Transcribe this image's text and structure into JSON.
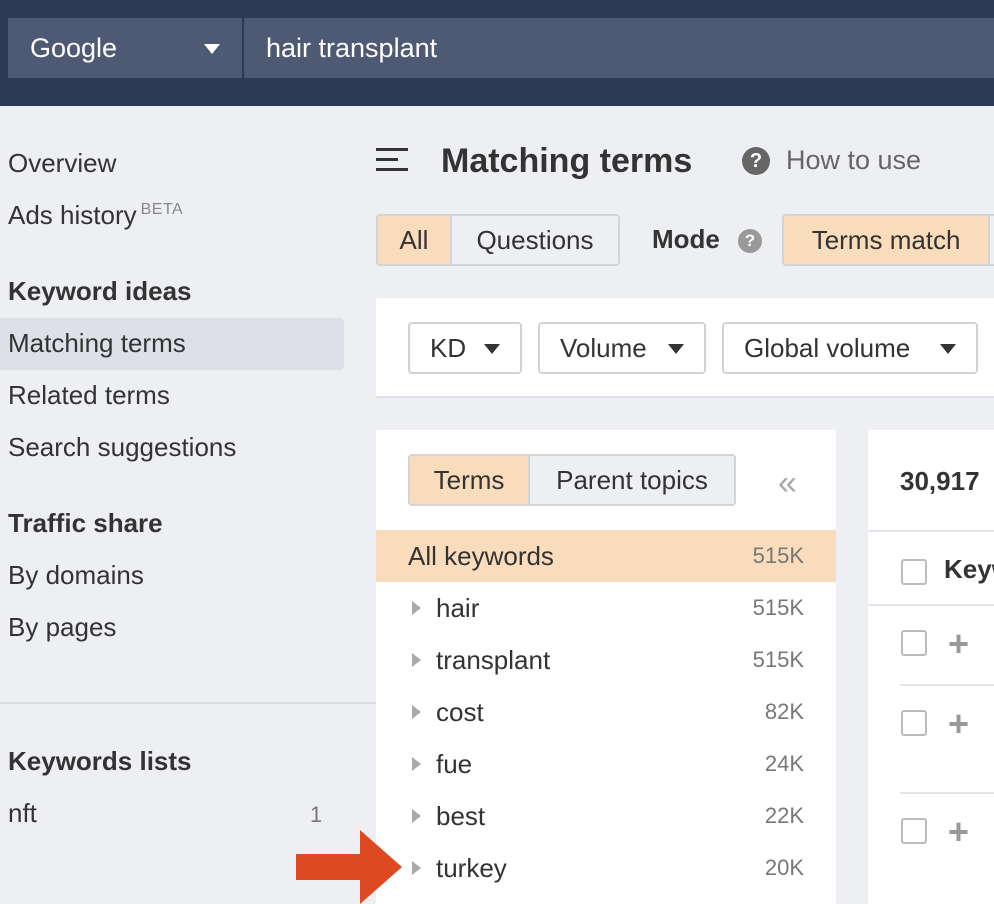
{
  "topbar": {
    "engine": "Google",
    "query": "hair transplant"
  },
  "sidebar": {
    "overview": "Overview",
    "ads_history": "Ads history",
    "beta_badge": "BETA",
    "keyword_ideas_heading": "Keyword ideas",
    "matching_terms": "Matching terms",
    "related_terms": "Related terms",
    "search_suggestions": "Search suggestions",
    "traffic_share_heading": "Traffic share",
    "by_domains": "By domains",
    "by_pages": "By pages",
    "keywords_lists_heading": "Keywords lists",
    "lists": [
      {
        "name": "nft",
        "count": "1"
      }
    ]
  },
  "header": {
    "title": "Matching terms",
    "how_to_use": "How to use",
    "help_icon_text": "?"
  },
  "type_toggle": {
    "all": "All",
    "questions": "Questions"
  },
  "mode": {
    "label": "Mode",
    "help_icon_text": "?",
    "terms_match": "Terms match"
  },
  "filters": {
    "kd": "KD",
    "volume": "Volume",
    "global_volume": "Global volume"
  },
  "terms_panel": {
    "tab_terms": "Terms",
    "tab_parent_topics": "Parent topics",
    "collapse_icon": "«",
    "rows": [
      {
        "label": "All keywords",
        "count": "515K"
      },
      {
        "label": "hair",
        "count": "515K"
      },
      {
        "label": "transplant",
        "count": "515K"
      },
      {
        "label": "cost",
        "count": "82K"
      },
      {
        "label": "fue",
        "count": "24K"
      },
      {
        "label": "best",
        "count": "22K"
      },
      {
        "label": "turkey",
        "count": "20K"
      }
    ]
  },
  "results": {
    "count": "30,917",
    "column_keyword": "Keyw",
    "plus_icon": "+"
  },
  "colors": {
    "topbar": "#2e3a55",
    "active_orange": "#f9dcbb",
    "annotation_arrow": "#dd4a22"
  }
}
